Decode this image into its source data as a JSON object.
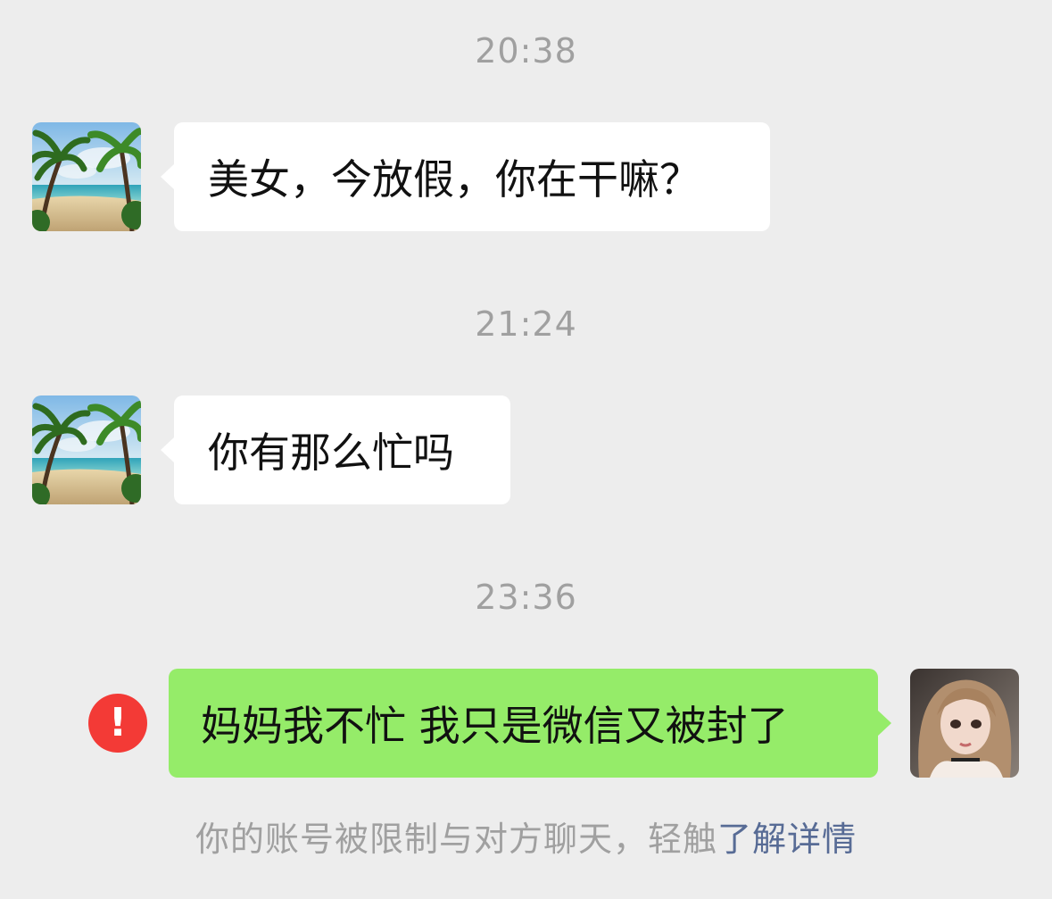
{
  "messages": [
    {
      "timestamp": "20:38",
      "direction": "incoming",
      "avatar_icon": "beach-palm-avatar",
      "text": "美女，今放假，你在干嘛？"
    },
    {
      "timestamp": "21:24",
      "direction": "incoming",
      "avatar_icon": "beach-palm-avatar",
      "text": "你有那么忙吗"
    },
    {
      "timestamp": "23:36",
      "direction": "outgoing",
      "avatar_icon": "girl-portrait-avatar",
      "text": "妈妈我不忙 我只是微信又被封了",
      "status_icon": "error-exclamation-icon",
      "status_symbol": "!"
    }
  ],
  "notice": {
    "text": "你的账号被限制与对方聊天，轻触",
    "link_text": "了解详情"
  },
  "colors": {
    "background": "#ededed",
    "incoming_bubble": "#ffffff",
    "outgoing_bubble": "#95ec69",
    "timestamp_text": "#a0a0a0",
    "link": "#576b95",
    "error_badge": "#f33a36"
  }
}
